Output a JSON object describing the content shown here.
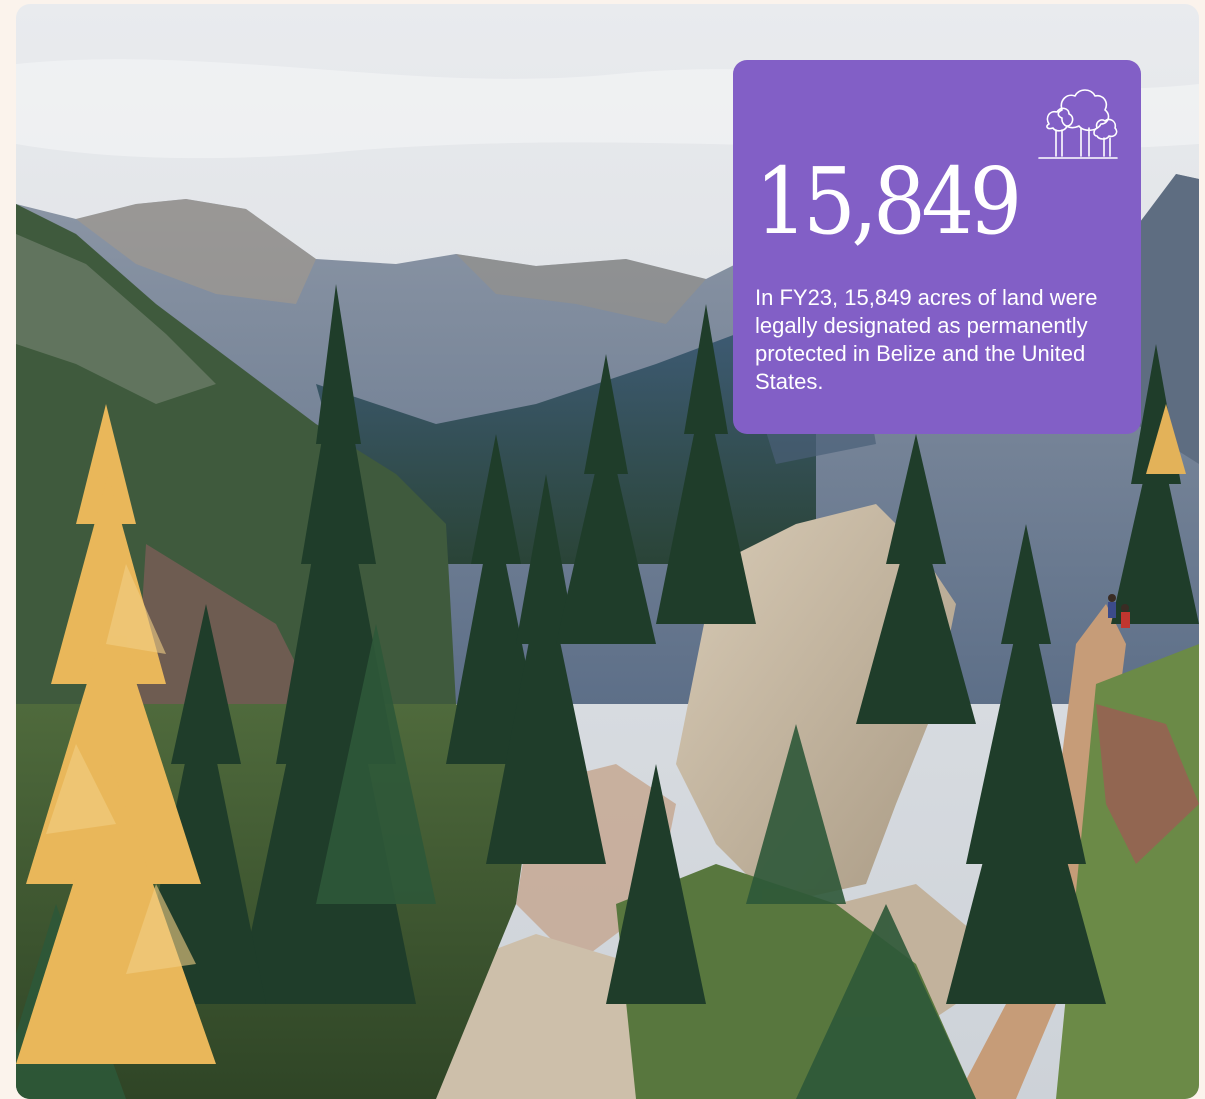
{
  "stat": {
    "value": "15,849",
    "description": "In FY23, 15,849 acres of land were legally designated as permanently protected in Belize and the United States.",
    "card_color": "#825fc6",
    "icon": "trees-icon"
  },
  "photo": {
    "subject": "mountain-forest-trail",
    "sky_color": "#dcdfe2",
    "mountain_color": "#6a7c95",
    "forest_color": "#23452f",
    "larch_color": "#e9b75a",
    "rock_color": "#c9bba5"
  },
  "page": {
    "background": "#fbf3ec"
  }
}
